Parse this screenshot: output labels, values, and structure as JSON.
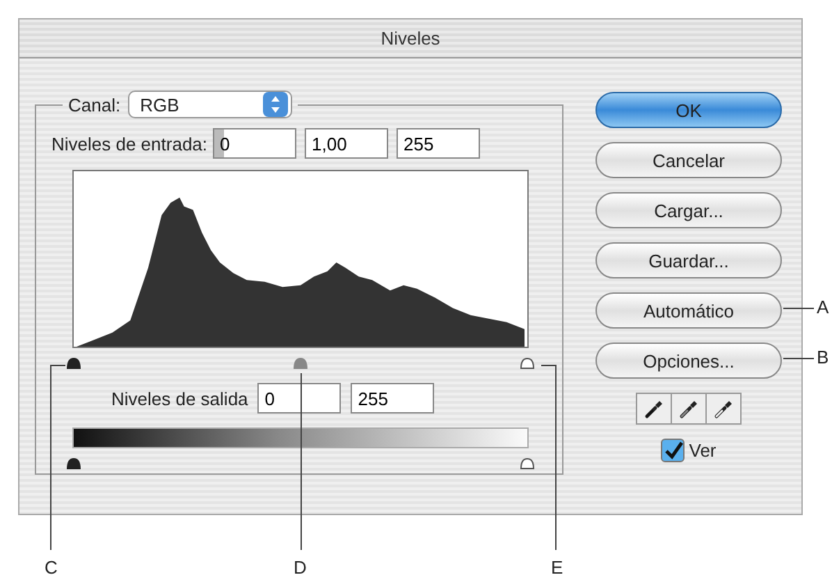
{
  "window": {
    "title": "Niveles"
  },
  "channel": {
    "label": "Canal:",
    "value": "RGB"
  },
  "input_levels": {
    "label": "Niveles de entrada:",
    "values": [
      "0",
      "1,00",
      "255"
    ]
  },
  "output_levels": {
    "label": "Niveles de salida",
    "values": [
      "0",
      "255"
    ]
  },
  "buttons": [
    {
      "label": "OK",
      "default": true
    },
    {
      "label": "Cancelar",
      "default": false
    },
    {
      "label": "Cargar...",
      "default": false
    },
    {
      "label": "Guardar...",
      "default": false
    },
    {
      "label": "Automático",
      "default": false
    },
    {
      "label": "Opciones...",
      "default": false
    }
  ],
  "preview": {
    "label": "Ver",
    "checked": true
  },
  "callouts": [
    {
      "label": "A"
    },
    {
      "label": "B"
    },
    {
      "label": "C"
    },
    {
      "label": "D"
    },
    {
      "label": "E"
    }
  ]
}
